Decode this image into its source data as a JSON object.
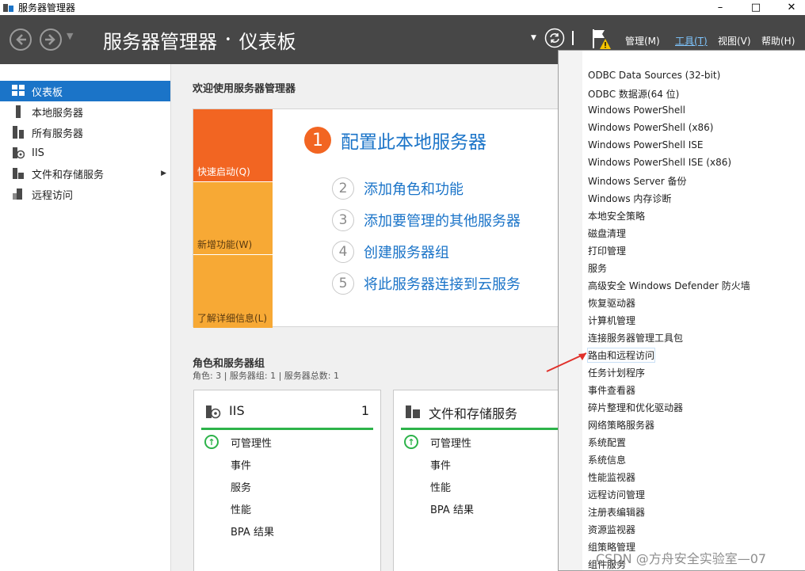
{
  "window": {
    "title": "服务器管理器",
    "controls": [
      "–",
      "□",
      "✕"
    ]
  },
  "header": {
    "breadcrumb_root": "服务器管理器",
    "breadcrumb_sep": "•",
    "breadcrumb_page": "仪表板",
    "menus": {
      "manage": "管理(M)",
      "tools": "工具(T)",
      "view": "视图(V)",
      "help": "帮助(H)"
    }
  },
  "sidebar": {
    "items": [
      {
        "label": "仪表板",
        "icon": "dashboard-icon",
        "selected": true
      },
      {
        "label": "本地服务器",
        "icon": "server-icon"
      },
      {
        "label": "所有服务器",
        "icon": "servers-icon"
      },
      {
        "label": "IIS",
        "icon": "iis-icon"
      },
      {
        "label": "文件和存储服务",
        "icon": "storage-icon",
        "has_submenu": true
      },
      {
        "label": "远程访问",
        "icon": "remote-access-icon"
      }
    ]
  },
  "welcome": {
    "title": "欢迎使用服务器管理器",
    "tiles": [
      "快速启动(Q)",
      "新增功能(W)",
      "了解详细信息(L)"
    ],
    "step1": {
      "num": "1",
      "text": "配置此本地服务器"
    },
    "steps": [
      {
        "num": "2",
        "text": "添加角色和功能"
      },
      {
        "num": "3",
        "text": "添加要管理的其他服务器"
      },
      {
        "num": "4",
        "text": "创建服务器组"
      },
      {
        "num": "5",
        "text": "将此服务器连接到云服务"
      }
    ]
  },
  "roles": {
    "title": "角色和服务器组",
    "subtitle": "角色: 3 | 服务器组: 1 | 服务器总数: 1",
    "cards": [
      {
        "title": "IIS",
        "count": "1",
        "rows": [
          "可管理性",
          "事件",
          "服务",
          "性能",
          "BPA 结果"
        ]
      },
      {
        "title": "文件和存储服务",
        "count": "",
        "rows": [
          "可管理性",
          "事件",
          "性能",
          "BPA 结果"
        ]
      }
    ]
  },
  "tools_menu": {
    "items": [
      "ODBC Data Sources (32-bit)",
      "ODBC 数据源(64 位)",
      "Windows PowerShell",
      "Windows PowerShell (x86)",
      "Windows PowerShell ISE",
      "Windows PowerShell ISE (x86)",
      "Windows Server 备份",
      "Windows 内存诊断",
      "本地安全策略",
      "磁盘清理",
      "打印管理",
      "服务",
      "高级安全 Windows Defender 防火墙",
      "恢复驱动器",
      "计算机管理",
      "连接服务器管理工具包",
      "路由和远程访问",
      "任务计划程序",
      "事件查看器",
      "碎片整理和优化驱动器",
      "网络策略服务器",
      "系统配置",
      "系统信息",
      "性能监视器",
      "远程访问管理",
      "注册表编辑器",
      "资源监视器",
      "组策略管理",
      "组件服务"
    ],
    "highlighted": "路由和远程访问"
  },
  "watermark": "CSDN @方舟安全实验室—07",
  "colors": {
    "header_bg": "#474747",
    "selection_blue": "#1b74c8",
    "tile_orange": "#f26522",
    "tile_yellow": "#f7a935",
    "status_green": "#2db34a",
    "annotation_red": "#e0302a"
  }
}
